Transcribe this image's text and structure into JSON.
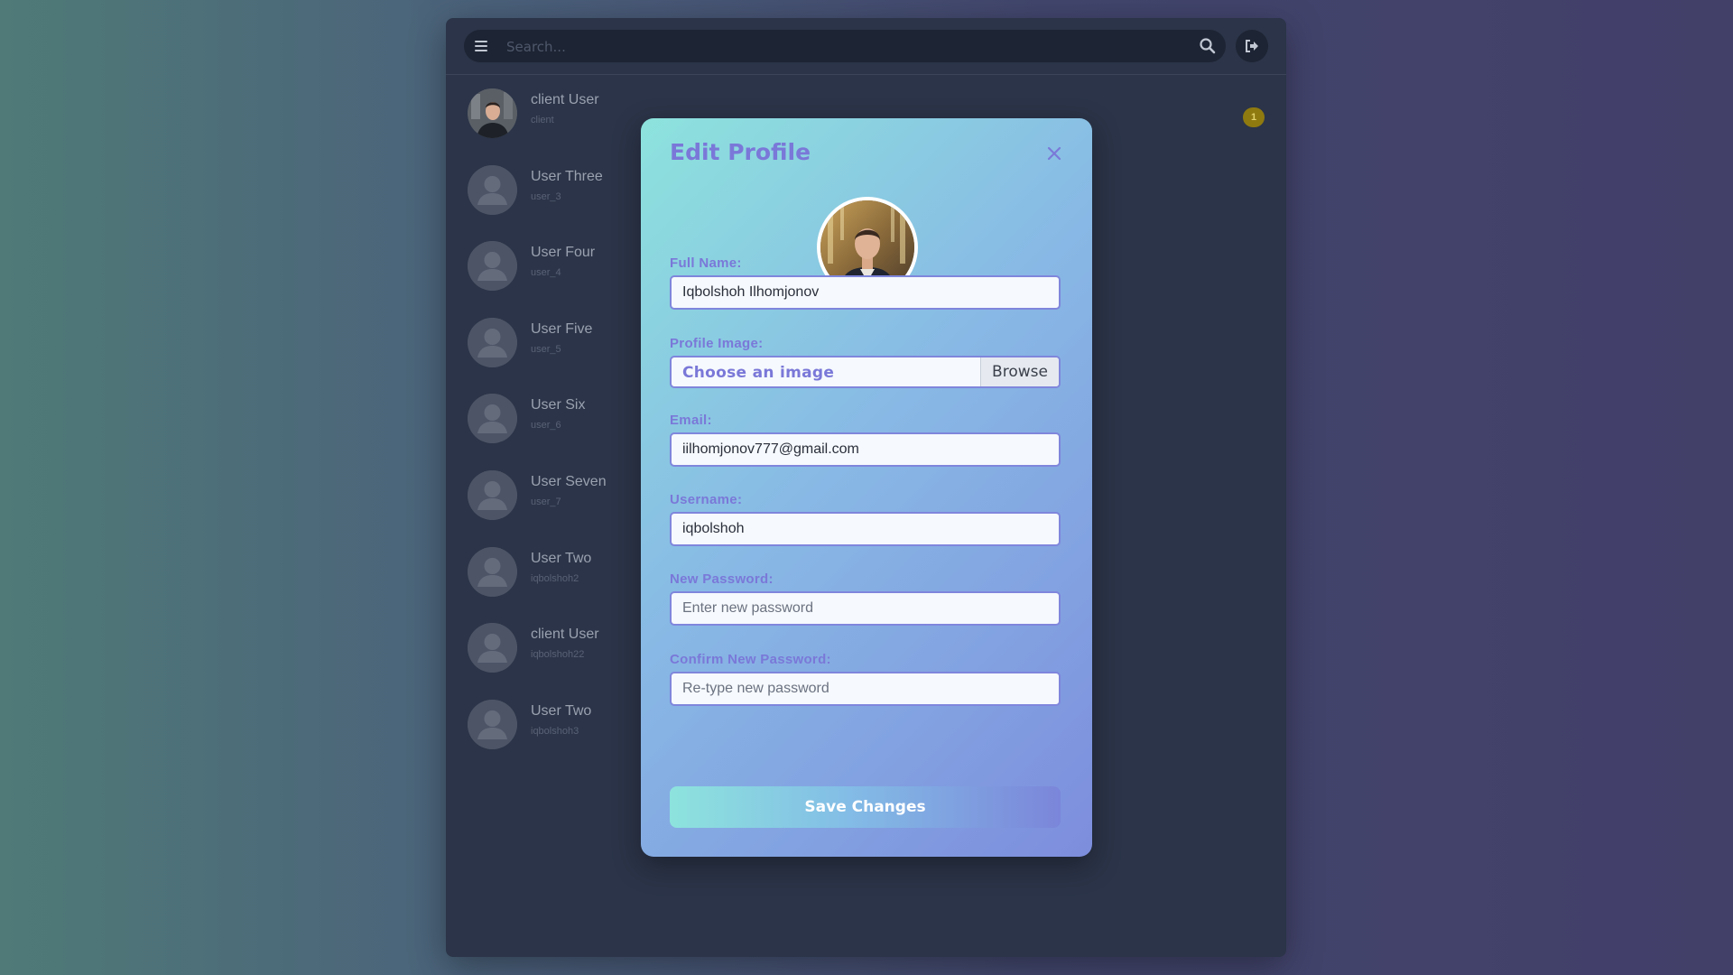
{
  "search": {
    "placeholder": "Search..."
  },
  "icons": {
    "menu": "menu-icon",
    "search": "search-icon",
    "logout": "logout-icon",
    "close": "close-icon"
  },
  "users": [
    {
      "name": "client User",
      "handle": "client",
      "has_photo": true
    },
    {
      "name": "User Three",
      "handle": "user_3",
      "has_photo": false
    },
    {
      "name": "User Four",
      "handle": "user_4",
      "has_photo": false
    },
    {
      "name": "User Five",
      "handle": "user_5",
      "has_photo": false
    },
    {
      "name": "User Six",
      "handle": "user_6",
      "has_photo": false
    },
    {
      "name": "User Seven",
      "handle": "user_7",
      "has_photo": false
    },
    {
      "name": "User Two",
      "handle": "iqbolshoh2",
      "has_photo": false
    },
    {
      "name": "client User",
      "handle": "iqbolshoh22",
      "has_photo": false
    },
    {
      "name": "User Two",
      "handle": "iqbolshoh3",
      "has_photo": false
    }
  ],
  "notification_badge": "1",
  "modal": {
    "title": "Edit Profile",
    "full_name_label": "Full Name:",
    "full_name_value": "Iqbolshoh Ilhomjonov",
    "profile_image_label": "Profile Image:",
    "file_placeholder": "Choose an image",
    "browse_label": "Browse",
    "email_label": "Email:",
    "email_value": "iilhomjonov777@gmail.com",
    "username_label": "Username:",
    "username_value": "iqbolshoh",
    "new_password_label": "New Password:",
    "new_password_placeholder": "Enter new password",
    "confirm_password_label": "Confirm New Password:",
    "confirm_password_placeholder": "Re-type new password",
    "save_label": "Save Changes"
  },
  "colors": {
    "accent": "#7a78d8",
    "modal_gradient_start": "#8de3dd",
    "modal_gradient_end": "#7d8ddd",
    "app_bg": "#2b3448",
    "badge_bg": "#8f7a10"
  }
}
